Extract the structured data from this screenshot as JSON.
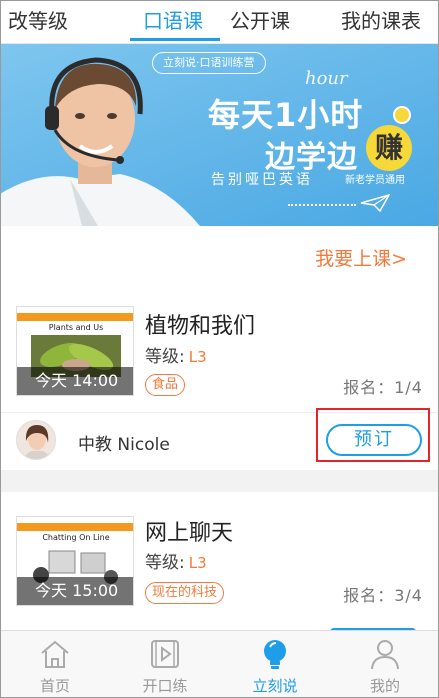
{
  "top_tabs": [
    {
      "label": "改等级"
    },
    {
      "label": "口语课",
      "active": true
    },
    {
      "label": "公开课"
    },
    {
      "label": "我的课表"
    }
  ],
  "banner": {
    "pill": "立刻说·口语训练营",
    "hour_word": "hour",
    "line1": "每天1小时",
    "line2": "边学边",
    "earn": "赚",
    "slogan": "告别哑巴英语",
    "tag": "新老学员通用"
  },
  "go_to_class": "我要上课>",
  "courses": [
    {
      "thumb_caption": "Plants and Us",
      "time": "今天 14:00",
      "title": "植物和我们",
      "level_label": "等级:",
      "level_value": "L3",
      "tag": "食品",
      "enroll": "报名：1/4",
      "teacher": "中教 Nicole",
      "book_label": "预订"
    },
    {
      "thumb_caption": "Chatting On Line",
      "time": "今天 15:00",
      "title": "网上聊天",
      "level_label": "等级:",
      "level_value": "L3",
      "tag": "现在的科技",
      "enroll": "报名：3/4"
    }
  ],
  "bottom_nav": [
    {
      "label": "首页",
      "icon": "home-icon"
    },
    {
      "label": "开口练",
      "icon": "play-icon"
    },
    {
      "label": "立刻说",
      "icon": "bulb-icon",
      "active": true
    },
    {
      "label": "我的",
      "icon": "person-icon"
    }
  ],
  "colors": {
    "accent_blue": "#1e9ee8",
    "accent_orange": "#f27a3e",
    "highlight_red": "#e0252b"
  }
}
